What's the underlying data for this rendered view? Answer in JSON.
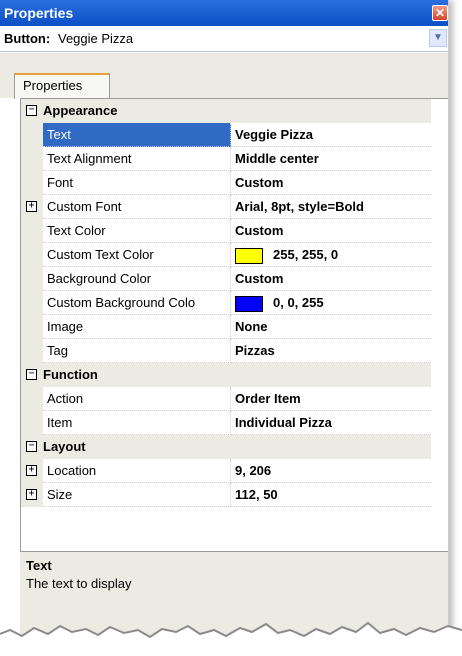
{
  "window": {
    "title": "Properties"
  },
  "selector": {
    "type": "Button:",
    "name": "Veggie Pizza"
  },
  "tabs": [
    {
      "label": "Properties"
    }
  ],
  "grid": {
    "categories": [
      {
        "name": "Appearance",
        "rows": [
          {
            "label": "Text",
            "value": "Veggie Pizza",
            "selected": true
          },
          {
            "label": "Text Alignment",
            "value": "Middle center"
          },
          {
            "label": "Font",
            "value": "Custom"
          },
          {
            "label": "Custom Font",
            "value": "Arial, 8pt, style=Bold",
            "expandable": true
          },
          {
            "label": "Text Color",
            "value": "Custom"
          },
          {
            "label": "Custom Text Color",
            "value": "255, 255, 0",
            "swatch": "#ffff00"
          },
          {
            "label": "Background Color",
            "value": "Custom"
          },
          {
            "label": "Custom Background Colo",
            "value": "0, 0, 255",
            "swatch": "#0000ff"
          },
          {
            "label": "Image",
            "value": "None"
          },
          {
            "label": "Tag",
            "value": "Pizzas"
          }
        ]
      },
      {
        "name": "Function",
        "rows": [
          {
            "label": "Action",
            "value": "Order Item"
          },
          {
            "label": "Item",
            "value": "Individual Pizza"
          }
        ]
      },
      {
        "name": "Layout",
        "rows": [
          {
            "label": "Location",
            "value": "9, 206",
            "expandable": true
          },
          {
            "label": "Size",
            "value": "112, 50",
            "expandable": true
          }
        ]
      }
    ]
  },
  "description": {
    "title": "Text",
    "text": "The text to display"
  },
  "colors": {
    "selection": "#316ac5",
    "titlebar": "#0b4fc6",
    "category_bg": "#ecebe3"
  },
  "icons": {
    "close": "close-icon",
    "dropdown": "chevron-down-icon",
    "collapse": "minus-box-icon",
    "expand": "plus-box-icon"
  }
}
